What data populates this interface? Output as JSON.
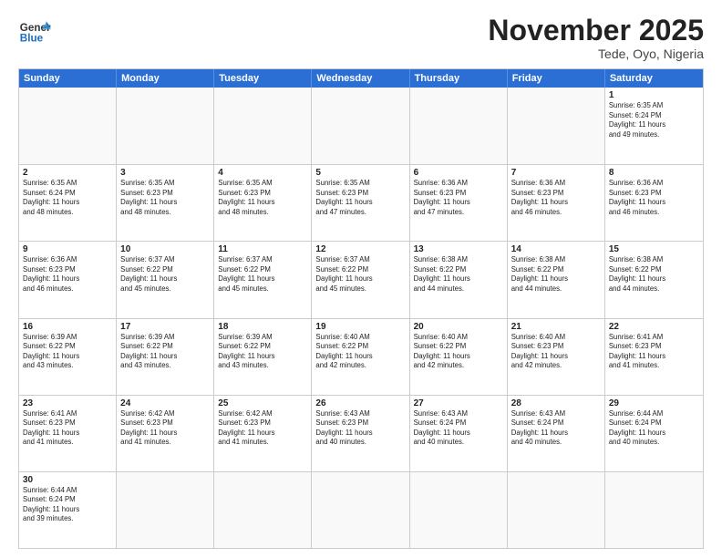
{
  "header": {
    "logo_general": "General",
    "logo_blue": "Blue",
    "month_title": "November 2025",
    "location": "Tede, Oyo, Nigeria"
  },
  "weekdays": [
    "Sunday",
    "Monday",
    "Tuesday",
    "Wednesday",
    "Thursday",
    "Friday",
    "Saturday"
  ],
  "weeks": [
    [
      {
        "day": "",
        "info": ""
      },
      {
        "day": "",
        "info": ""
      },
      {
        "day": "",
        "info": ""
      },
      {
        "day": "",
        "info": ""
      },
      {
        "day": "",
        "info": ""
      },
      {
        "day": "",
        "info": ""
      },
      {
        "day": "1",
        "info": "Sunrise: 6:35 AM\nSunset: 6:24 PM\nDaylight: 11 hours\nand 49 minutes."
      }
    ],
    [
      {
        "day": "2",
        "info": "Sunrise: 6:35 AM\nSunset: 6:24 PM\nDaylight: 11 hours\nand 48 minutes."
      },
      {
        "day": "3",
        "info": "Sunrise: 6:35 AM\nSunset: 6:23 PM\nDaylight: 11 hours\nand 48 minutes."
      },
      {
        "day": "4",
        "info": "Sunrise: 6:35 AM\nSunset: 6:23 PM\nDaylight: 11 hours\nand 48 minutes."
      },
      {
        "day": "5",
        "info": "Sunrise: 6:35 AM\nSunset: 6:23 PM\nDaylight: 11 hours\nand 47 minutes."
      },
      {
        "day": "6",
        "info": "Sunrise: 6:36 AM\nSunset: 6:23 PM\nDaylight: 11 hours\nand 47 minutes."
      },
      {
        "day": "7",
        "info": "Sunrise: 6:36 AM\nSunset: 6:23 PM\nDaylight: 11 hours\nand 46 minutes."
      },
      {
        "day": "8",
        "info": "Sunrise: 6:36 AM\nSunset: 6:23 PM\nDaylight: 11 hours\nand 46 minutes."
      }
    ],
    [
      {
        "day": "9",
        "info": "Sunrise: 6:36 AM\nSunset: 6:23 PM\nDaylight: 11 hours\nand 46 minutes."
      },
      {
        "day": "10",
        "info": "Sunrise: 6:37 AM\nSunset: 6:22 PM\nDaylight: 11 hours\nand 45 minutes."
      },
      {
        "day": "11",
        "info": "Sunrise: 6:37 AM\nSunset: 6:22 PM\nDaylight: 11 hours\nand 45 minutes."
      },
      {
        "day": "12",
        "info": "Sunrise: 6:37 AM\nSunset: 6:22 PM\nDaylight: 11 hours\nand 45 minutes."
      },
      {
        "day": "13",
        "info": "Sunrise: 6:38 AM\nSunset: 6:22 PM\nDaylight: 11 hours\nand 44 minutes."
      },
      {
        "day": "14",
        "info": "Sunrise: 6:38 AM\nSunset: 6:22 PM\nDaylight: 11 hours\nand 44 minutes."
      },
      {
        "day": "15",
        "info": "Sunrise: 6:38 AM\nSunset: 6:22 PM\nDaylight: 11 hours\nand 44 minutes."
      }
    ],
    [
      {
        "day": "16",
        "info": "Sunrise: 6:39 AM\nSunset: 6:22 PM\nDaylight: 11 hours\nand 43 minutes."
      },
      {
        "day": "17",
        "info": "Sunrise: 6:39 AM\nSunset: 6:22 PM\nDaylight: 11 hours\nand 43 minutes."
      },
      {
        "day": "18",
        "info": "Sunrise: 6:39 AM\nSunset: 6:22 PM\nDaylight: 11 hours\nand 43 minutes."
      },
      {
        "day": "19",
        "info": "Sunrise: 6:40 AM\nSunset: 6:22 PM\nDaylight: 11 hours\nand 42 minutes."
      },
      {
        "day": "20",
        "info": "Sunrise: 6:40 AM\nSunset: 6:22 PM\nDaylight: 11 hours\nand 42 minutes."
      },
      {
        "day": "21",
        "info": "Sunrise: 6:40 AM\nSunset: 6:23 PM\nDaylight: 11 hours\nand 42 minutes."
      },
      {
        "day": "22",
        "info": "Sunrise: 6:41 AM\nSunset: 6:23 PM\nDaylight: 11 hours\nand 41 minutes."
      }
    ],
    [
      {
        "day": "23",
        "info": "Sunrise: 6:41 AM\nSunset: 6:23 PM\nDaylight: 11 hours\nand 41 minutes."
      },
      {
        "day": "24",
        "info": "Sunrise: 6:42 AM\nSunset: 6:23 PM\nDaylight: 11 hours\nand 41 minutes."
      },
      {
        "day": "25",
        "info": "Sunrise: 6:42 AM\nSunset: 6:23 PM\nDaylight: 11 hours\nand 41 minutes."
      },
      {
        "day": "26",
        "info": "Sunrise: 6:43 AM\nSunset: 6:23 PM\nDaylight: 11 hours\nand 40 minutes."
      },
      {
        "day": "27",
        "info": "Sunrise: 6:43 AM\nSunset: 6:24 PM\nDaylight: 11 hours\nand 40 minutes."
      },
      {
        "day": "28",
        "info": "Sunrise: 6:43 AM\nSunset: 6:24 PM\nDaylight: 11 hours\nand 40 minutes."
      },
      {
        "day": "29",
        "info": "Sunrise: 6:44 AM\nSunset: 6:24 PM\nDaylight: 11 hours\nand 40 minutes."
      }
    ],
    [
      {
        "day": "30",
        "info": "Sunrise: 6:44 AM\nSunset: 6:24 PM\nDaylight: 11 hours\nand 39 minutes."
      },
      {
        "day": "",
        "info": ""
      },
      {
        "day": "",
        "info": ""
      },
      {
        "day": "",
        "info": ""
      },
      {
        "day": "",
        "info": ""
      },
      {
        "day": "",
        "info": ""
      },
      {
        "day": "",
        "info": ""
      }
    ]
  ]
}
